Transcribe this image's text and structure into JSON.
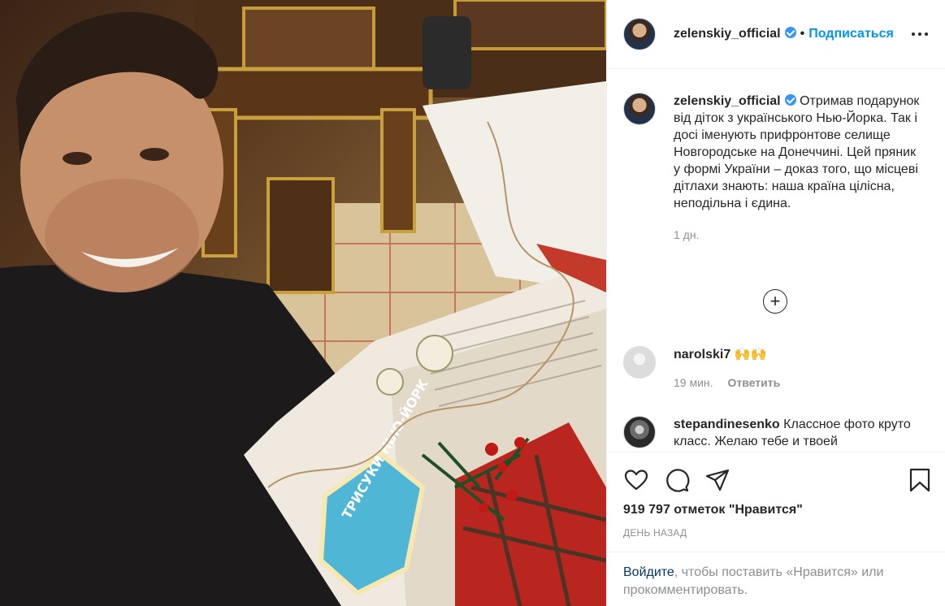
{
  "post": {
    "username": "zelenskiy_official",
    "dot": "•",
    "follow_label": "Подписаться",
    "caption": "Отримав подарунок від діток з українського Нью-Йорка. Так і досі іменують прифронтове селище Новгородське на Донеччині. Цей пряник у формі України – доказ того, що місцеві дітлахи знають: наша країна цілісна, неподільна і єдина.",
    "caption_time": "1 дн.",
    "load_more": "+"
  },
  "photo": {
    "cookie_text": "ТРИСУКИ НЬЮ-ЙОРК"
  },
  "comments": [
    {
      "username": "narolski7",
      "text": "🙌🙌",
      "time": "19 мин.",
      "reply_label": "Ответить"
    },
    {
      "username": "stepandinesenko",
      "text": "Классное фото круто класс. Желаю тебе и твоей"
    }
  ],
  "actions": {
    "likes": "919 797 отметок \"Нравится\"",
    "time": "ДЕНЬ НАЗАД"
  },
  "login": {
    "link": "Войдите",
    "rest": ", чтобы поставить «Нравится» или прокомментировать."
  },
  "colors": {
    "accent": "#0095f6",
    "verified": "#3897f0",
    "text": "#262626",
    "muted": "#8e8e8e"
  }
}
